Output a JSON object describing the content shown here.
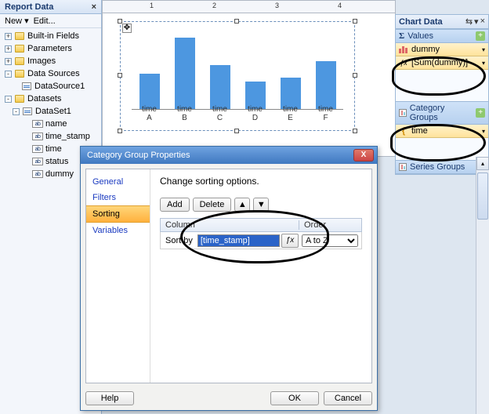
{
  "report_data": {
    "title": "Report Data",
    "toolbar": {
      "new": "New",
      "edit": "Edit..."
    },
    "tree": [
      {
        "label": "Built-in Fields",
        "depth": 0,
        "expand": "+",
        "icon": "folder"
      },
      {
        "label": "Parameters",
        "depth": 0,
        "expand": "+",
        "icon": "folder"
      },
      {
        "label": "Images",
        "depth": 0,
        "expand": "+",
        "icon": "folder"
      },
      {
        "label": "Data Sources",
        "depth": 0,
        "expand": "-",
        "icon": "folder"
      },
      {
        "label": "DataSource1",
        "depth": 1,
        "expand": "",
        "icon": "ds"
      },
      {
        "label": "Datasets",
        "depth": 0,
        "expand": "-",
        "icon": "folder"
      },
      {
        "label": "DataSet1",
        "depth": 1,
        "expand": "-",
        "icon": "ds"
      },
      {
        "label": "name",
        "depth": 2,
        "expand": "",
        "icon": "fld"
      },
      {
        "label": "time_stamp",
        "depth": 2,
        "expand": "",
        "icon": "fld"
      },
      {
        "label": "time",
        "depth": 2,
        "expand": "",
        "icon": "fld"
      },
      {
        "label": "status",
        "depth": 2,
        "expand": "",
        "icon": "fld"
      },
      {
        "label": "dummy",
        "depth": 2,
        "expand": "",
        "icon": "fld"
      }
    ]
  },
  "chart_data": {
    "type": "bar",
    "categories": [
      "time A",
      "time B",
      "time C",
      "time D",
      "time E",
      "time F"
    ],
    "values": [
      45,
      90,
      55,
      35,
      40,
      60
    ],
    "title": "",
    "xlabel": "",
    "ylabel": "",
    "ylim": [
      0,
      100
    ]
  },
  "chart_panel": {
    "title": "Chart Data",
    "sections": {
      "values": {
        "head": "Values",
        "items": [
          {
            "icon": "bar",
            "label": "dummy"
          },
          {
            "icon": "fx",
            "label": "[Sum(dummy)]"
          }
        ]
      },
      "category": {
        "head": "Category Groups",
        "items": [
          {
            "icon": "cat",
            "label": "time"
          }
        ]
      },
      "series": {
        "head": "Series Groups",
        "items": []
      }
    }
  },
  "dialog": {
    "title": "Category Group Properties",
    "nav": [
      "General",
      "Filters",
      "Sorting",
      "Variables"
    ],
    "nav_selected": 2,
    "heading": "Change sorting options.",
    "buttons": {
      "add": "Add",
      "delete": "Delete"
    },
    "grid": {
      "col1": "Column",
      "col2": "Order",
      "sort_by_label": "Sort by",
      "expression": "[time_stamp]",
      "order": "A to Z"
    },
    "footer": {
      "help": "Help",
      "ok": "OK",
      "cancel": "Cancel"
    }
  }
}
